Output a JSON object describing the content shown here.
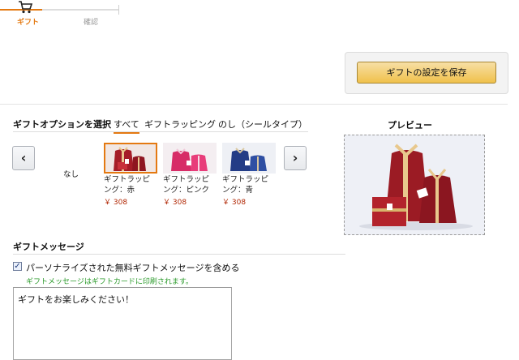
{
  "stepper": {
    "steps": [
      {
        "label": "ギフト",
        "active": true,
        "icon": "cart-icon"
      },
      {
        "label": "確認",
        "active": false
      }
    ]
  },
  "save_panel": {
    "save_label": "ギフトの設定を保存"
  },
  "gift_options": {
    "title": "ギフトオプションを選択",
    "tabs": [
      "すべて",
      "ギフトラッピング",
      "のし（シールタイプ）"
    ],
    "active_tab": "すべて",
    "items": [
      {
        "name": "なし",
        "price": ""
      },
      {
        "name": "ギフトラッピング：赤",
        "price": "￥ 308",
        "selected": true,
        "color": "#b01c28"
      },
      {
        "name": "ギフトラッピング：ピンク",
        "price": "￥ 308",
        "color": "#e0306e"
      },
      {
        "name": "ギフトラッピング：青",
        "price": "￥ 308",
        "color": "#243f8f"
      }
    ]
  },
  "preview": {
    "title": "プレビュー"
  },
  "gift_message": {
    "title": "ギフトメッセージ",
    "checkbox_label": "パーソナライズされた無料ギフトメッセージを含める",
    "checked": true,
    "hint": "ギフトメッセージはギフトカードに印刷されます。",
    "message": "ギフトをお楽しみください！"
  },
  "colors": {
    "accent": "#e47911",
    "price": "#b12704",
    "hint": "#2c9b2c",
    "button": "#f0c14b"
  }
}
